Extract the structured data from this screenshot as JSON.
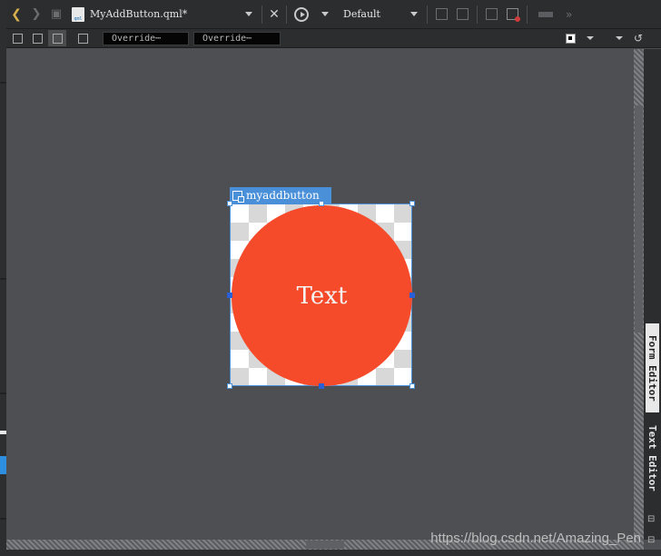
{
  "toolbar": {
    "file_name": "MyAddButton.qml*",
    "file_type": "qml",
    "config_label": "Default",
    "icons": [
      "back-arrow-icon",
      "forward-arrow-icon",
      "lock-icon",
      "file-icon",
      "close-icon",
      "run-icon"
    ]
  },
  "toolbar2": {
    "override_1": "Override⋯",
    "override_2": "Override⋯"
  },
  "canvas": {
    "component_id": "myaddbutton",
    "button_text": "Text",
    "button_color": "#f54b2a",
    "selection_color": "#4a90d9"
  },
  "side_tabs": {
    "form_editor": "Form Editor",
    "text_editor": "Text Editor"
  },
  "watermark": "https://blog.csdn.net/Amazing_Pen"
}
